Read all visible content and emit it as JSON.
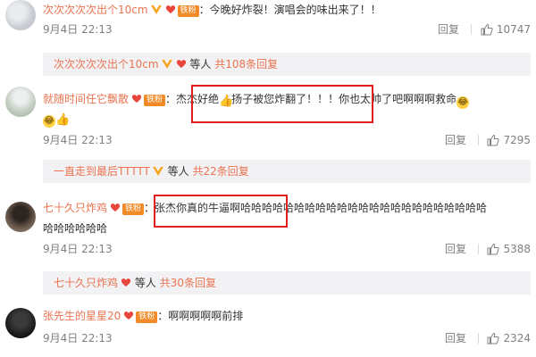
{
  "comments": [
    {
      "user": "次次次次次出个10cm",
      "fan_badge": "铁粉",
      "text": "：今晚好炸裂！演唱会的味出来了！！",
      "time": "9月4日 22:13",
      "reply_label": "回复",
      "likes": "10747",
      "replies": {
        "user": "次次次次次出个10cm",
        "others": "等人",
        "count_text": "共108条回复"
      }
    },
    {
      "user": "就随时间任它飘散",
      "fan_badge": "铁粉",
      "text_a": "：",
      "text_b": "杰杰好绝",
      "text_c": "扬子被您炸翻了！！！你也太帅了吧啊啊啊救命",
      "time": "9月4日 22:13",
      "reply_label": "回复",
      "likes": "7295",
      "replies": {
        "user": "一直走到最后TTTTT",
        "others": "等人",
        "count_text": "共22条回复"
      }
    },
    {
      "user": "七十久只炸鸡",
      "fan_badge": "铁粉",
      "text_line1": "：张杰你真的牛逼啊哈哈哈哈哈哈哈哈哈哈哈哈哈哈哈哈哈哈哈哈哈哈哈",
      "text_line2": "哈哈哈哈哈哈",
      "time": "9月4日 22:13",
      "reply_label": "回复",
      "likes": "5388",
      "replies": {
        "user": "七十久只炸鸡",
        "others": "等人",
        "count_text": "共30条回复"
      }
    },
    {
      "user": "张先生的星星20",
      "fan_badge": "铁粉",
      "text": "：啊啊啊啊啊前排",
      "time": "9月4日 22:13",
      "reply_label": "回复",
      "likes": "2324"
    }
  ],
  "icons": {
    "like": "thumbs-up-icon",
    "vip": "vip-v-icon",
    "heart": "fan-heart-icon",
    "emoji_laugh": "laugh-cry-emoji",
    "emoji_thumb": "thumbs-up-emoji"
  },
  "colors": {
    "username": "#eb7350",
    "meta": "#808080",
    "highlight": "#e0201a",
    "fan_badge": "#f28a28",
    "reply_bar": "#f2f2f5"
  }
}
